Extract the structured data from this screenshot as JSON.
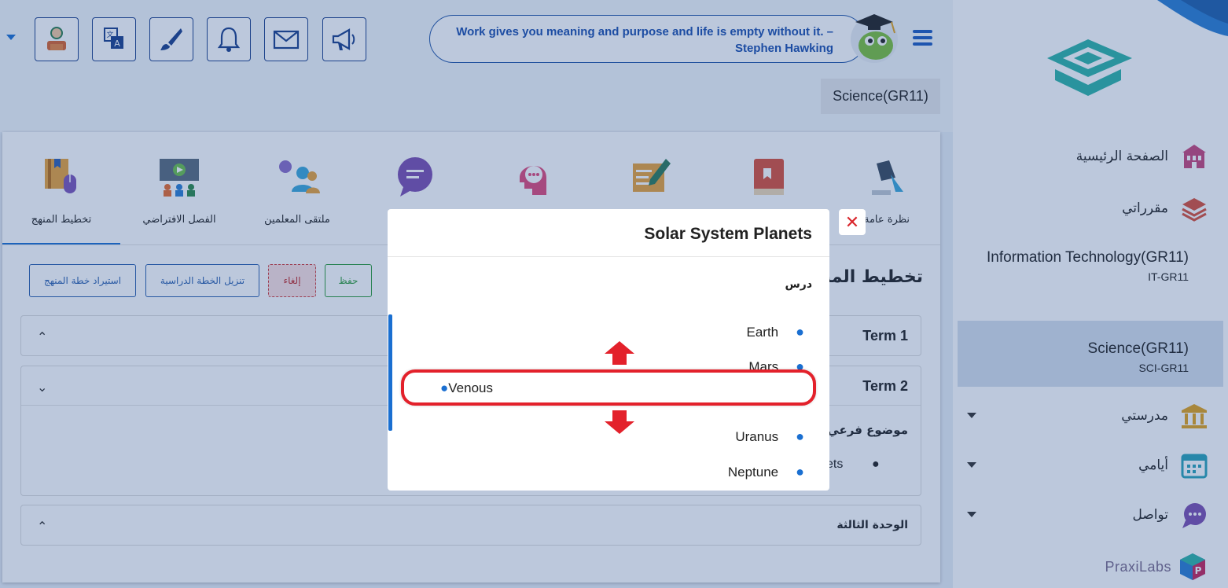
{
  "header": {
    "quote": "Work gives you meaning and purpose and life is empty without it. – Stephen Hawking",
    "course_chip": "Science(GR11)",
    "tools": [
      "profile-icon",
      "translate-icon",
      "brush-icon",
      "bell-icon",
      "mail-icon",
      "megaphone-icon"
    ]
  },
  "tabs": [
    {
      "label": "تخطيط المنهج",
      "icon": "curriculum-planning-icon"
    },
    {
      "label": "الفصل الافتراضي",
      "icon": "virtual-class-icon"
    },
    {
      "label": "ملتقى المعلمين",
      "icon": "teachers-forum-icon"
    },
    {
      "label": "",
      "icon": "chat-bubble-icon"
    },
    {
      "label": "",
      "icon": "mind-icon"
    },
    {
      "label": "",
      "icon": "edit-notes-icon"
    },
    {
      "label": "",
      "icon": "book-icon"
    },
    {
      "label": "نظرة عامة",
      "icon": "overview-icon"
    }
  ],
  "actions": {
    "restore": "استيراد خطة المنهج",
    "download": "تنزيل الخطة الدراسية",
    "cancel": "إلغاء",
    "save": "حفظ"
  },
  "plan": {
    "title": "تخطيط المنهج",
    "term1": "Term 1",
    "term2": "Term 2",
    "subtopic": "موضوع فرعي",
    "subtopic_item": "ets",
    "unit3": "الوحدة الثالثة"
  },
  "modal": {
    "title": "Solar System Planets",
    "lesson_label": "درس",
    "planets": [
      "Earth",
      "Mars",
      "Uranus",
      "Neptune"
    ],
    "dragging": "Venous",
    "close": "✕"
  },
  "sidebar": {
    "nav": {
      "home": "الصفحة الرئيسية",
      "courses": "مقرراتي",
      "school": "مدرستي",
      "days": "أيامي",
      "contact": "تواصل"
    },
    "courses": [
      {
        "name": "Information Technology(GR11)",
        "code": "IT-GR11"
      },
      {
        "name": "Science(GR11)",
        "code": "SCI-GR11"
      }
    ],
    "brand": "PraxiLabs"
  },
  "colors": {
    "accent": "#1a6fd1",
    "navy": "#1a3f8c",
    "danger": "#e3212b",
    "success": "#2c9b3a",
    "overlay": "rgba(32,74,140,0.30)"
  }
}
